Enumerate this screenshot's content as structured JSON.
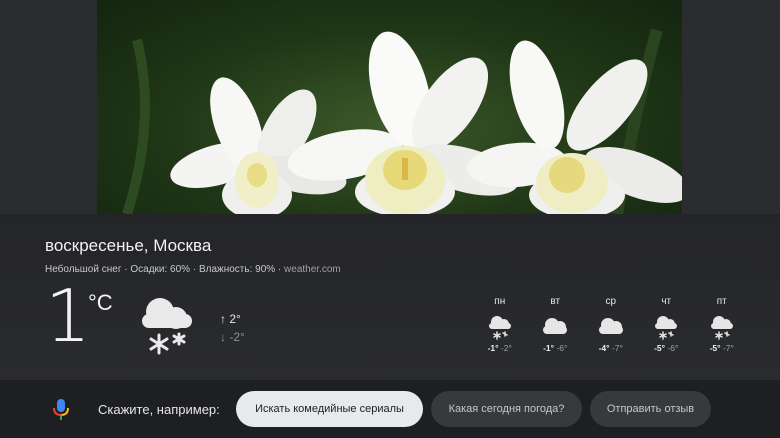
{
  "weather": {
    "title": "воскресенье, Москва",
    "conditions": "Небольшой снег · Осадки: 60% · Влажность: 90% · ",
    "source": "weather.com",
    "temperature": "1",
    "unit": "°C",
    "icon": "cloud-snow-icon",
    "high": "↑ 2°",
    "low": "↓ -2°"
  },
  "forecast": [
    {
      "day": "пн",
      "icon": "cloud-snow-icon",
      "max": "-1°",
      "min": "-2°"
    },
    {
      "day": "вт",
      "icon": "cloud-icon",
      "max": "-1°",
      "min": "-6°"
    },
    {
      "day": "ср",
      "icon": "cloud-icon",
      "max": "-4°",
      "min": "-7°"
    },
    {
      "day": "чт",
      "icon": "cloud-snow-icon",
      "max": "-5°",
      "min": "-6°"
    },
    {
      "day": "пт",
      "icon": "cloud-snow-icon",
      "max": "-5°",
      "min": "-7°"
    }
  ],
  "assistant": {
    "prompt": "Скажите, например:",
    "suggestions": [
      "Искать комедийные сериалы",
      "Какая сегодня погода?",
      "Отправить отзыв"
    ],
    "mic_colors": [
      "#4285f4",
      "#ea4335",
      "#fbbc05",
      "#34a853"
    ]
  }
}
